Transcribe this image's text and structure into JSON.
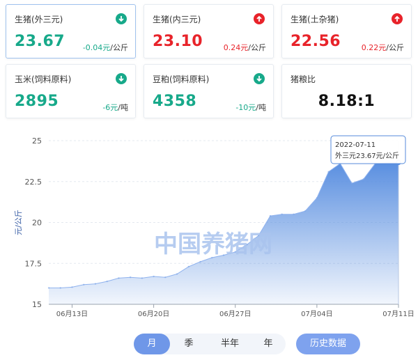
{
  "cards": [
    {
      "name": "生猪(外三元)",
      "price": "23.67",
      "change": "-0.04元",
      "unit": "/公斤",
      "direction": "down"
    },
    {
      "name": "生猪(内三元)",
      "price": "23.10",
      "change": "0.24元",
      "unit": "/公斤",
      "direction": "up"
    },
    {
      "name": "生猪(土杂猪)",
      "price": "22.56",
      "change": "0.22元",
      "unit": "/公斤",
      "direction": "up"
    },
    {
      "name": "玉米(饲料原料)",
      "price": "2895",
      "change": "-6元",
      "unit": "/吨",
      "direction": "down"
    },
    {
      "name": "豆粕(饲料原料)",
      "price": "4358",
      "change": "-10元",
      "unit": "/吨",
      "direction": "down"
    },
    {
      "name": "猪粮比",
      "ratio": "8.18:1"
    }
  ],
  "colors": {
    "up": "#e8232a",
    "down": "#17a98a",
    "accent": "#6f97e8",
    "area": "#5a8fe0"
  },
  "watermark": "中国养猪网",
  "tooltip": {
    "date": "2022-07-11",
    "text": "外三元23.67元/公斤"
  },
  "tabs": [
    "月",
    "季",
    "半年",
    "年"
  ],
  "active_tab": "月",
  "history_button": "历史数据",
  "chart_data": {
    "type": "area",
    "ylabel": "元/公斤",
    "ylim": [
      15,
      25
    ],
    "yticks": [
      "25",
      "22.5",
      "20",
      "17.5",
      "15"
    ],
    "xticks": [
      "06月13日",
      "06月20日",
      "06月27日",
      "07月04日",
      "07月11日"
    ],
    "x": [
      "06-11",
      "06-12",
      "06-13",
      "06-14",
      "06-15",
      "06-16",
      "06-17",
      "06-18",
      "06-19",
      "06-20",
      "06-21",
      "06-22",
      "06-23",
      "06-24",
      "06-25",
      "06-26",
      "06-27",
      "06-28",
      "06-29",
      "06-30",
      "07-01",
      "07-02",
      "07-03",
      "07-04",
      "07-05",
      "07-06",
      "07-07",
      "07-08",
      "07-09",
      "07-10",
      "07-11"
    ],
    "series": [
      {
        "values": [
          16.0,
          16.0,
          16.05,
          16.2,
          16.25,
          16.4,
          16.6,
          16.65,
          16.6,
          16.7,
          16.65,
          16.85,
          17.3,
          17.6,
          17.85,
          18.0,
          18.2,
          18.65,
          19.2,
          20.4,
          20.5,
          20.5,
          20.7,
          21.5,
          23.1,
          23.6,
          22.4,
          22.65,
          23.6,
          23.65,
          23.67
        ]
      }
    ],
    "grid": true,
    "legend": "none"
  }
}
